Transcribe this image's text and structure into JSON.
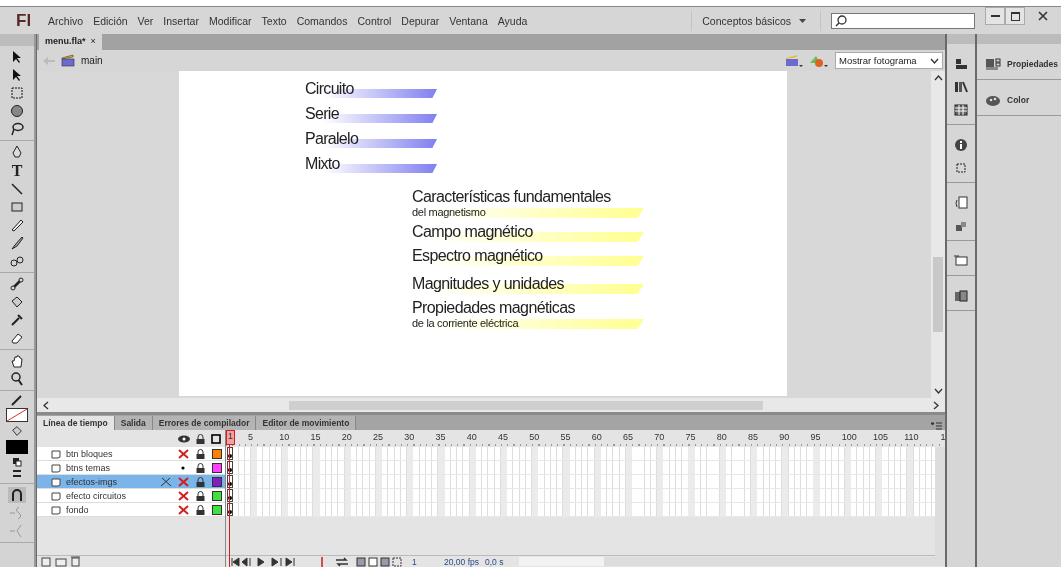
{
  "app": {
    "logo": "Fl",
    "menu": [
      "Archivo",
      "Edición",
      "Ver",
      "Insertar",
      "Modificar",
      "Texto",
      "Comandos",
      "Control",
      "Depurar",
      "Ventana",
      "Ayuda"
    ],
    "workspace": "Conceptos básicos"
  },
  "document": {
    "tab": "menu.fla*",
    "close": "×",
    "scene": "main",
    "view_dropdown": "Mostrar fotograma"
  },
  "tools": {
    "text_tool_glyph": "T"
  },
  "stage": {
    "circuit_buttons": [
      {
        "label": "Circuito"
      },
      {
        "label": "Serie"
      },
      {
        "label": "Paralelo"
      },
      {
        "label": "Mixto"
      }
    ],
    "topic_buttons": [
      {
        "label": "Características fundamentales",
        "sublabel": "del magnetismo"
      },
      {
        "label": "Campo magnético"
      },
      {
        "label": "Espectro magnético"
      },
      {
        "label": "Magnitudes y unidades"
      },
      {
        "label": "Propiedades magnéticas",
        "sublabel": "de la corriente eléctrica"
      }
    ]
  },
  "timeline": {
    "tabs": [
      {
        "label": "Línea de tiempo",
        "selected": true
      },
      {
        "label": "Salida",
        "selected": false
      },
      {
        "label": "Errores de compilador",
        "selected": false
      },
      {
        "label": "Editor de movimiento",
        "selected": false
      }
    ],
    "frame_numbers": [
      "1",
      "5",
      "10",
      "15",
      "20",
      "25",
      "30",
      "35",
      "40",
      "45",
      "50",
      "55",
      "60",
      "65",
      "70",
      "75",
      "80",
      "85",
      "90",
      "95",
      "100",
      "105",
      "110",
      "1"
    ],
    "layers": [
      {
        "name": "btn bloques",
        "hidden": true,
        "locked": true,
        "color": "#ff8000",
        "selected": false
      },
      {
        "name": "btns temas",
        "hidden": false,
        "locked": true,
        "color": "#ff40ff",
        "selected": false
      },
      {
        "name": "efectos-imgs",
        "hidden": true,
        "locked": true,
        "color": "#8020c0",
        "selected": true
      },
      {
        "name": "efecto circuitos",
        "hidden": true,
        "locked": true,
        "color": "#40e040",
        "selected": false
      },
      {
        "name": "fondo",
        "hidden": true,
        "locked": true,
        "color": "#40e040",
        "selected": false
      }
    ],
    "status": {
      "frame": "1",
      "fps": "20,00 fps",
      "time": "0,0 s"
    }
  },
  "panels": [
    {
      "label": "Propiedades"
    },
    {
      "label": "Color"
    }
  ]
}
